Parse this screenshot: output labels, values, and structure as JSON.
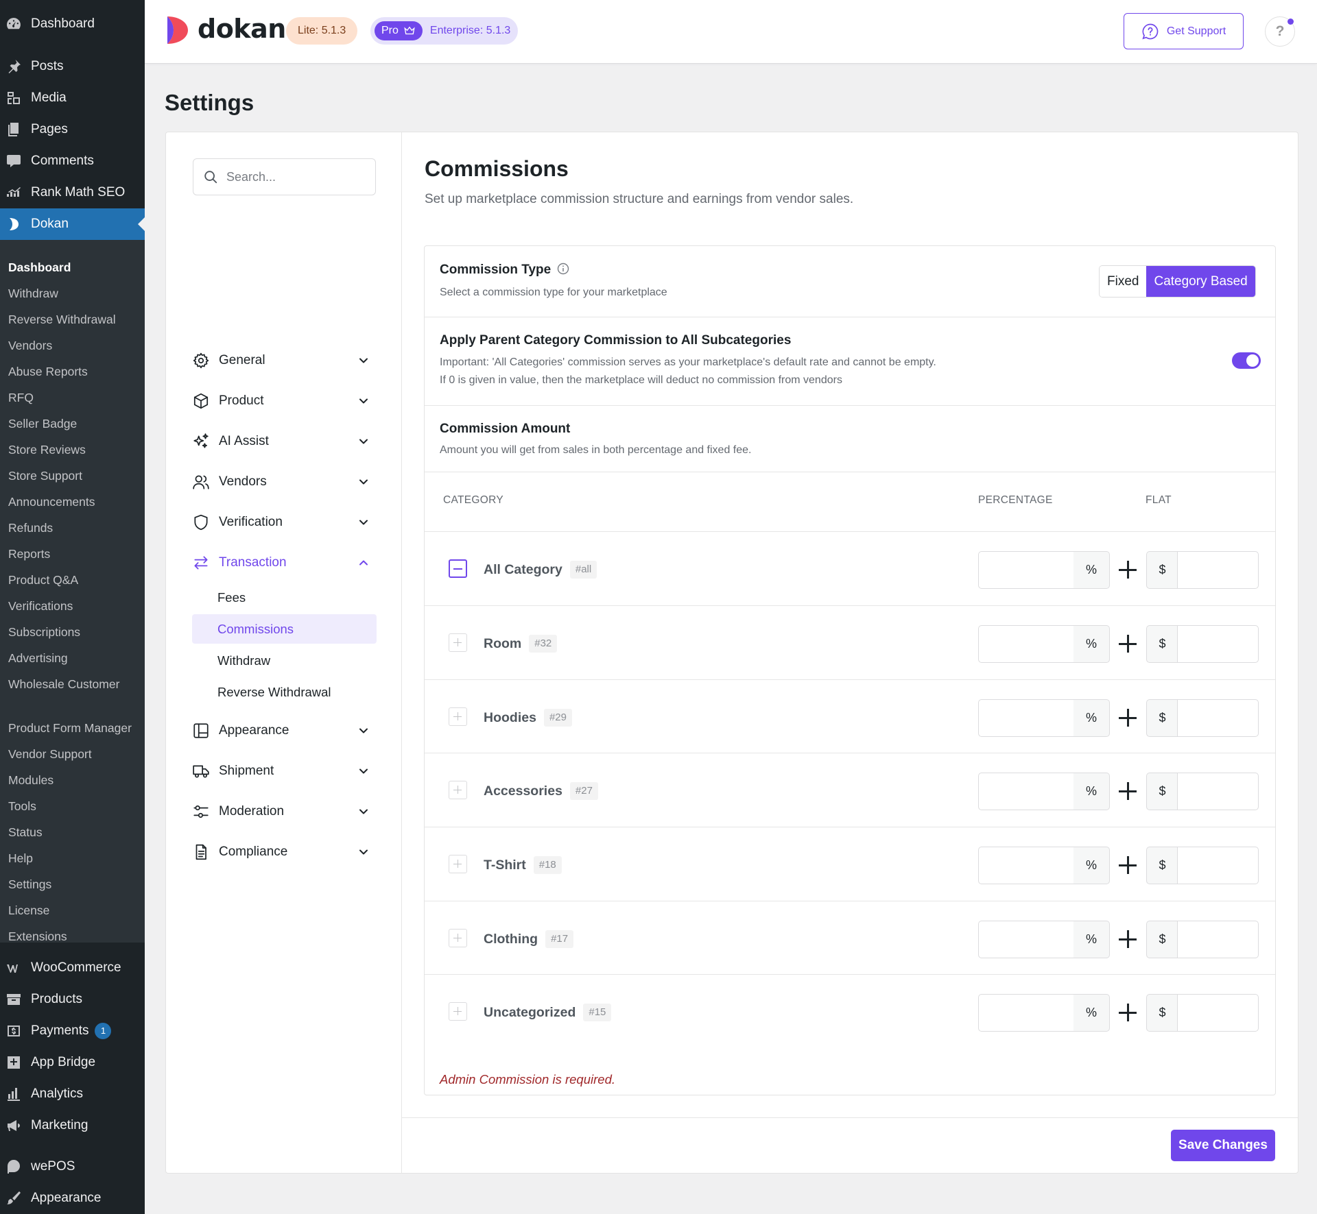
{
  "wp_menu": {
    "top": [
      {
        "label": "Dashboard",
        "icon": "dashboard-icon"
      },
      {
        "label": "Posts",
        "icon": "pushpin-icon"
      },
      {
        "label": "Media",
        "icon": "media-icon"
      },
      {
        "label": "Pages",
        "icon": "pages-icon"
      },
      {
        "label": "Comments",
        "icon": "comment-icon"
      },
      {
        "label": "Rank Math SEO",
        "icon": "rank-math-icon"
      },
      {
        "label": "Dokan",
        "icon": "dokan-icon"
      }
    ],
    "dokan_submenu": [
      "Dashboard",
      "Withdraw",
      "Reverse Withdrawal",
      "Vendors",
      "Abuse Reports",
      "RFQ",
      "Seller Badge",
      "Store Reviews",
      "Store Support",
      "Announcements",
      "Refunds",
      "Reports",
      "Product Q&A",
      "Verifications",
      "Subscriptions",
      "Advertising",
      "Wholesale Customer",
      "Product Form Manager",
      "Vendor Support",
      "Modules",
      "Tools",
      "Status",
      "Help",
      "Settings",
      "License",
      "Extensions"
    ],
    "bottom": [
      {
        "label": "WooCommerce",
        "icon": "woocommerce-icon"
      },
      {
        "label": "Products",
        "icon": "archive-icon"
      },
      {
        "label": "Payments",
        "icon": "payments-icon",
        "badge": "1"
      },
      {
        "label": "App Bridge",
        "icon": "app-bridge-icon"
      },
      {
        "label": "Analytics",
        "icon": "bar-chart-icon"
      },
      {
        "label": "Marketing",
        "icon": "megaphone-icon"
      },
      {
        "label": "wePOS",
        "icon": "wepos-icon"
      },
      {
        "label": "Appearance",
        "icon": "brush-icon"
      }
    ]
  },
  "header": {
    "brand": "dokan",
    "lite_badge": "Lite: 5.1.3",
    "pro_label": "Pro",
    "enterprise_label": "Enterprise: 5.1.3",
    "support_label": "Get Support",
    "help_label": "?"
  },
  "page_title": "Settings",
  "settings_nav": {
    "search_placeholder": "Search...",
    "items": [
      {
        "label": "General",
        "icon": "gear-icon"
      },
      {
        "label": "Product",
        "icon": "box-icon"
      },
      {
        "label": "AI Assist",
        "icon": "sparkles-icon"
      },
      {
        "label": "Vendors",
        "icon": "users-icon"
      },
      {
        "label": "Verification",
        "icon": "shield-icon"
      },
      {
        "label": "Transaction",
        "icon": "transfer-arrows-icon"
      },
      {
        "label": "Appearance",
        "icon": "layout-icon"
      },
      {
        "label": "Shipment",
        "icon": "truck-icon"
      },
      {
        "label": "Moderation",
        "icon": "sliders-icon"
      },
      {
        "label": "Compliance",
        "icon": "document-icon"
      }
    ],
    "transaction_sub": [
      "Fees",
      "Commissions",
      "Withdraw",
      "Reverse Withdrawal"
    ]
  },
  "content": {
    "title": "Commissions",
    "description": "Set up marketplace commission structure and earnings from vendor sales.",
    "commission_type": {
      "title": "Commission Type",
      "description": "Select a commission type for your marketplace",
      "options": [
        "Fixed",
        "Category Based"
      ],
      "selected": "Category Based"
    },
    "apply_parent": {
      "title": "Apply Parent Category Commission to All Subcategories",
      "desc_line1": "Important: 'All Categories' commission serves as your marketplace's default rate and cannot be empty.",
      "desc_line2": "If 0 is given in value, then the marketplace will deduct no commission from vendors",
      "enabled": true
    },
    "commission_amount": {
      "title": "Commission Amount",
      "description": "Amount you will get from sales in both percentage and fixed fee."
    },
    "table": {
      "headers": {
        "category": "CATEGORY",
        "percentage": "PERCENTAGE",
        "flat": "FLAT"
      },
      "percent_symbol": "%",
      "currency_symbol": "$",
      "rows": [
        {
          "name": "All Category",
          "tag": "#all",
          "expanded": true,
          "percentage": "",
          "flat": ""
        },
        {
          "name": "Room",
          "tag": "#32",
          "expanded": false,
          "percentage": "",
          "flat": ""
        },
        {
          "name": "Hoodies",
          "tag": "#29",
          "expanded": false,
          "percentage": "",
          "flat": ""
        },
        {
          "name": "Accessories",
          "tag": "#27",
          "expanded": false,
          "percentage": "",
          "flat": ""
        },
        {
          "name": "T-Shirt",
          "tag": "#18",
          "expanded": false,
          "percentage": "",
          "flat": ""
        },
        {
          "name": "Clothing",
          "tag": "#17",
          "expanded": false,
          "percentage": "",
          "flat": ""
        },
        {
          "name": "Uncategorized",
          "tag": "#15",
          "expanded": false,
          "percentage": "",
          "flat": ""
        }
      ]
    },
    "error": "Admin Commission is required.",
    "save_label": "Save Changes"
  },
  "colors": {
    "accent": "#7047eb",
    "wp_sidebar": "#1d2327",
    "wp_active": "#2271b1",
    "error": "#a0282a"
  }
}
